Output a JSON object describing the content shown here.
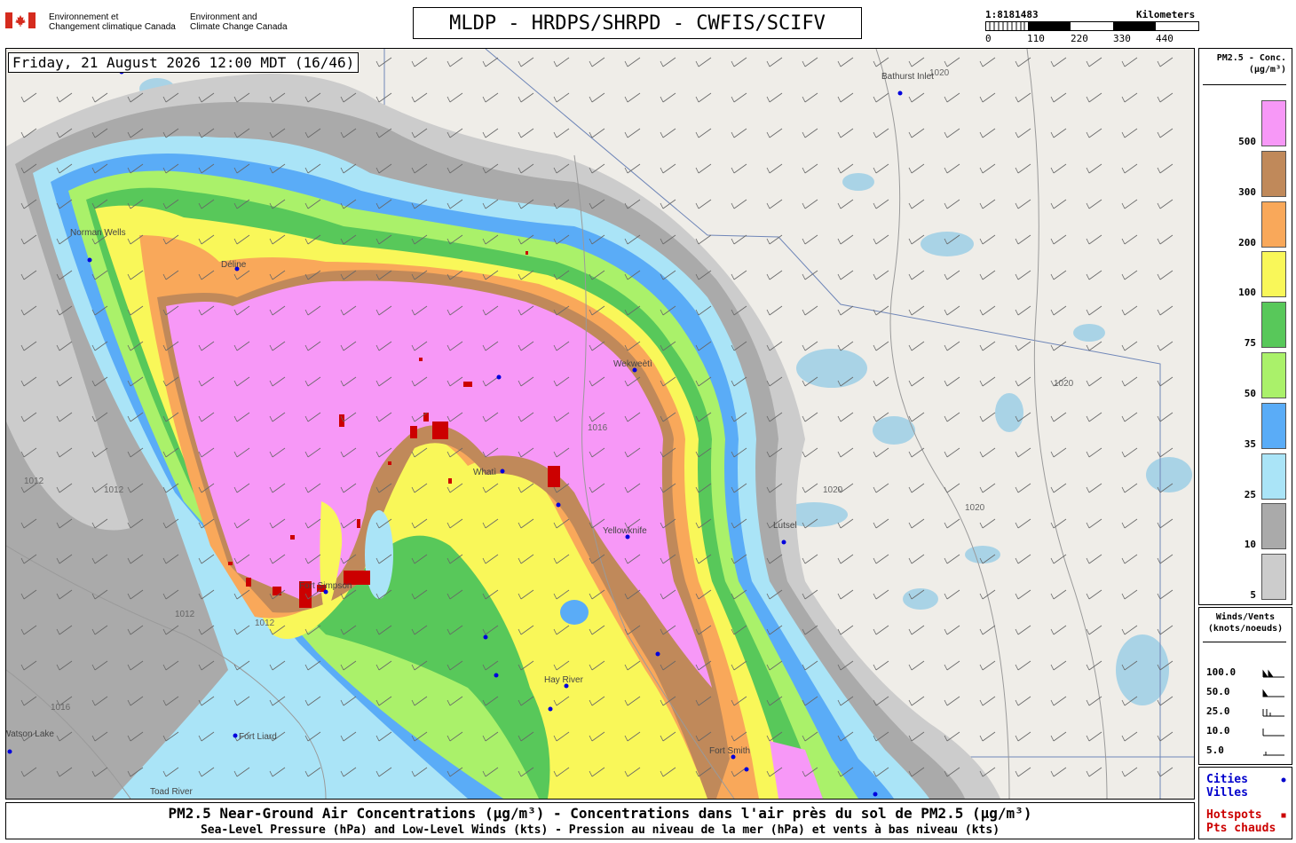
{
  "header": {
    "gov_fr_line1": "Environnement et",
    "gov_fr_line2": "Changement climatique Canada",
    "gov_en_line1": "Environment and",
    "gov_en_line2": "Climate Change Canada",
    "title": "MLDP - HRDPS/SHRPD - CWFIS/SCIFV",
    "scale_ratio": "1:8181483",
    "scale_unit": "Kilometers",
    "scale_ticks": [
      "0",
      "110",
      "220",
      "330",
      "440"
    ]
  },
  "map": {
    "datetime": "Friday, 21 August 2026 12:00 MDT (16/46)",
    "cities": [
      {
        "name": "Bathurst Inlet"
      },
      {
        "name": "Norman Wells"
      },
      {
        "name": "Déline"
      },
      {
        "name": "Wekweètì"
      },
      {
        "name": "Whatì"
      },
      {
        "name": "Yellowknife"
      },
      {
        "name": "Lutsel"
      },
      {
        "name": "Fort Simpson"
      },
      {
        "name": "Hay River"
      },
      {
        "name": "Fort Smith"
      },
      {
        "name": "Fort Liard"
      },
      {
        "name": "Toad River"
      },
      {
        "name": "Watson Lake"
      }
    ],
    "isobar_values": [
      "1020",
      "1016",
      "1012"
    ]
  },
  "legend": {
    "title_line1": "PM2.5 - Conc.",
    "title_line2": "(µg/m³)",
    "levels": [
      {
        "label": "500",
        "color": "#f798f7"
      },
      {
        "label": "300",
        "color": "#c0895a"
      },
      {
        "label": "200",
        "color": "#f9a85a"
      },
      {
        "label": "100",
        "color": "#f9f759"
      },
      {
        "label": "75",
        "color": "#58c85a"
      },
      {
        "label": "50",
        "color": "#aaf16a"
      },
      {
        "label": "35",
        "color": "#5aacf7"
      },
      {
        "label": "25",
        "color": "#aae4f7"
      },
      {
        "label": "10",
        "color": "#aaaaaa"
      },
      {
        "label": "5",
        "color": "#cccccc"
      }
    ]
  },
  "winds": {
    "title_line1": "Winds/Vents",
    "title_line2": "(knots/noeuds)",
    "speeds": [
      "100.0",
      "50.0",
      "25.0",
      "10.0",
      "5.0"
    ]
  },
  "key": {
    "cities_en": "Cities",
    "cities_fr": "Villes",
    "cities_color": "#0000cc",
    "hotspots_en": "Hotspots",
    "hotspots_fr": "Pts chauds",
    "hotspots_color": "#cc0000"
  },
  "footer": {
    "line1": "PM2.5 Near-Ground Air Concentrations (µg/m³) - Concentrations dans l'air près du sol de PM2.5 (µg/m³)",
    "line2": "Sea-Level Pressure (hPa) and Low-Level Winds (kts) - Pression au niveau de la mer (hPa) et vents à bas niveau (kts)"
  }
}
